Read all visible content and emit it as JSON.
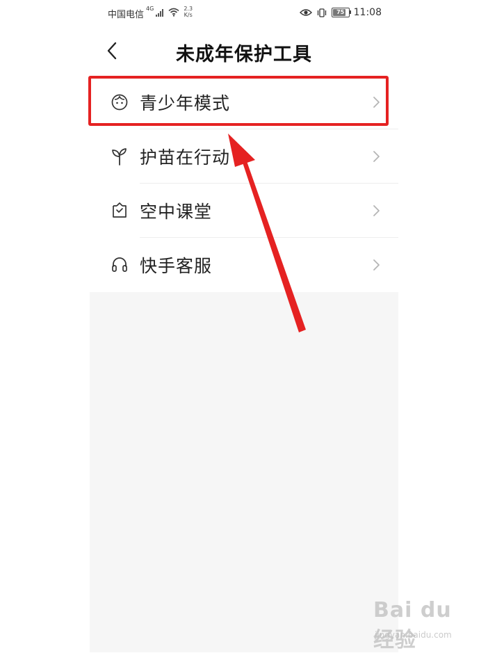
{
  "status_bar": {
    "carrier": "中国电信",
    "signal_label": "4G",
    "speed_value": "2.3",
    "speed_unit": "K/s",
    "battery": "75",
    "time": "11:08"
  },
  "header": {
    "title": "未成年保护工具",
    "back_icon": "chevron-left-icon"
  },
  "menu": {
    "items": [
      {
        "label": "青少年模式",
        "icon": "child-face-icon"
      },
      {
        "label": "护苗在行动",
        "icon": "sprout-icon"
      },
      {
        "label": "空中课堂",
        "icon": "classroom-icon"
      },
      {
        "label": "快手客服",
        "icon": "headset-icon"
      }
    ]
  },
  "annotation": {
    "highlight_color": "#e52222",
    "highlighted_item": "青少年模式"
  },
  "watermark": {
    "logo": "Bai du 经验",
    "url": "jingyan.baidu.com"
  },
  "colors": {
    "background": "#f6f6f6",
    "surface": "#ffffff",
    "text": "#222222",
    "accent_red": "#e52222"
  }
}
